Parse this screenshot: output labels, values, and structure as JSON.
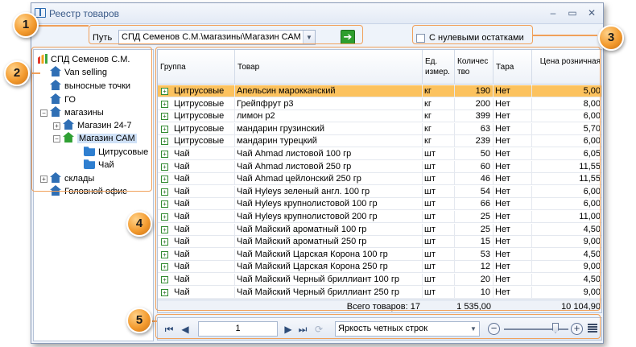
{
  "window": {
    "title": "Реестр товаров",
    "controls": [
      "minimize",
      "maximize",
      "close"
    ]
  },
  "toolbar": {
    "path_label": "Путь",
    "path_value": "СПД Семенов С.М.\\магазины\\Магазин САМ",
    "zero_stock_label": "С нулевыми остатками",
    "zero_stock_checked": false
  },
  "tree": {
    "items": [
      {
        "label": "СПД Семенов С.М.",
        "icon": "bars-icon",
        "level": 0,
        "expander": "minus"
      },
      {
        "label": "Van selling",
        "icon": "house-icon",
        "level": 1,
        "expander": null
      },
      {
        "label": "выносные точки",
        "icon": "house-icon",
        "level": 1,
        "expander": null
      },
      {
        "label": "ГО",
        "icon": "house-icon",
        "level": 1,
        "expander": null
      },
      {
        "label": "магазины",
        "icon": "house-icon",
        "level": 1,
        "expander": "minus"
      },
      {
        "label": "Магазин 24-7",
        "icon": "house-icon",
        "level": 2,
        "expander": "plus"
      },
      {
        "label": "Магазин САМ",
        "icon": "house-green-icon",
        "level": 2,
        "expander": "minus",
        "selected": true
      },
      {
        "label": "Цитрусовые",
        "icon": "folder-icon",
        "level": 3,
        "expander": null
      },
      {
        "label": "Чай",
        "icon": "folder-icon",
        "level": 3,
        "expander": null
      },
      {
        "label": "склады",
        "icon": "house-icon",
        "level": 1,
        "expander": "plus"
      },
      {
        "label": "Головной офис",
        "icon": "house-icon",
        "level": 1,
        "expander": null
      }
    ]
  },
  "grid": {
    "columns": [
      {
        "label": "Группа"
      },
      {
        "label": "Товар"
      },
      {
        "label": "Ед. измер."
      },
      {
        "label": "Количес тво"
      },
      {
        "label": "Тара"
      },
      {
        "label": "Цена розничная"
      }
    ],
    "rows": [
      {
        "group": "Цитрусовые",
        "product": "Апельсин марокканский",
        "unit": "кг",
        "qty": "190",
        "tara": "Нет",
        "price": "5,00",
        "selected": true
      },
      {
        "group": "Цитрусовые",
        "product": "Грейпфрут р3",
        "unit": "кг",
        "qty": "200",
        "tara": "Нет",
        "price": "8,00"
      },
      {
        "group": "Цитрусовые",
        "product": "лимон р2",
        "unit": "кг",
        "qty": "399",
        "tara": "Нет",
        "price": "6,00"
      },
      {
        "group": "Цитрусовые",
        "product": "мандарин грузинский",
        "unit": "кг",
        "qty": "63",
        "tara": "Нет",
        "price": "5,70"
      },
      {
        "group": "Цитрусовые",
        "product": "мандарин турецкий",
        "unit": "кг",
        "qty": "239",
        "tara": "Нет",
        "price": "6,00"
      },
      {
        "group": "Чай",
        "product": "Чай Ahmad листовой 100 гр",
        "unit": "шт",
        "qty": "50",
        "tara": "Нет",
        "price": "6,05"
      },
      {
        "group": "Чай",
        "product": "Чай Ahmad листовой 250 гр",
        "unit": "шт",
        "qty": "60",
        "tara": "Нет",
        "price": "11,55"
      },
      {
        "group": "Чай",
        "product": "Чай Ahmad цейлонский 250 гр",
        "unit": "шт",
        "qty": "46",
        "tara": "Нет",
        "price": "11,55"
      },
      {
        "group": "Чай",
        "product": "Чай Hyleys зеленый англ. 100 гр",
        "unit": "шт",
        "qty": "54",
        "tara": "Нет",
        "price": "6,00"
      },
      {
        "group": "Чай",
        "product": "Чай Hyleys крупнолистовой 100 гр",
        "unit": "шт",
        "qty": "66",
        "tara": "Нет",
        "price": "6,00"
      },
      {
        "group": "Чай",
        "product": "Чай Hyleys крупнолистовой 200 гр",
        "unit": "шт",
        "qty": "25",
        "tara": "Нет",
        "price": "11,00"
      },
      {
        "group": "Чай",
        "product": "Чай Майский ароматный 100 гр",
        "unit": "шт",
        "qty": "25",
        "tara": "Нет",
        "price": "4,50"
      },
      {
        "group": "Чай",
        "product": "Чай Майский ароматный 250 гр",
        "unit": "шт",
        "qty": "15",
        "tara": "Нет",
        "price": "9,00"
      },
      {
        "group": "Чай",
        "product": "Чай Майский Царская Корона 100 гр",
        "unit": "шт",
        "qty": "53",
        "tara": "Нет",
        "price": "4,50"
      },
      {
        "group": "Чай",
        "product": "Чай Майский Царская Корона 250 гр",
        "unit": "шт",
        "qty": "12",
        "tara": "Нет",
        "price": "9,00"
      },
      {
        "group": "Чай",
        "product": "Чай Майский Черный бриллиант 100 гр",
        "unit": "шт",
        "qty": "20",
        "tara": "Нет",
        "price": "4,50"
      },
      {
        "group": "Чай",
        "product": "Чай Майский Черный бриллиант 250 гр",
        "unit": "шт",
        "qty": "10",
        "tara": "Нет",
        "price": "9,00"
      }
    ],
    "footer": {
      "total_label": "Всего товаров: 17",
      "total_qty": "1 535,00",
      "total_price": "10 104,90"
    }
  },
  "navbar": {
    "page_value": "1",
    "stripe_select_value": "Яркость четных строк"
  },
  "callouts": [
    "1",
    "2",
    "3",
    "4",
    "5"
  ],
  "colors": {
    "selected_row": "#fcc25e",
    "callout": "#f39b2f",
    "accent_blue": "#2f6fb5",
    "accent_green": "#2fa033"
  }
}
